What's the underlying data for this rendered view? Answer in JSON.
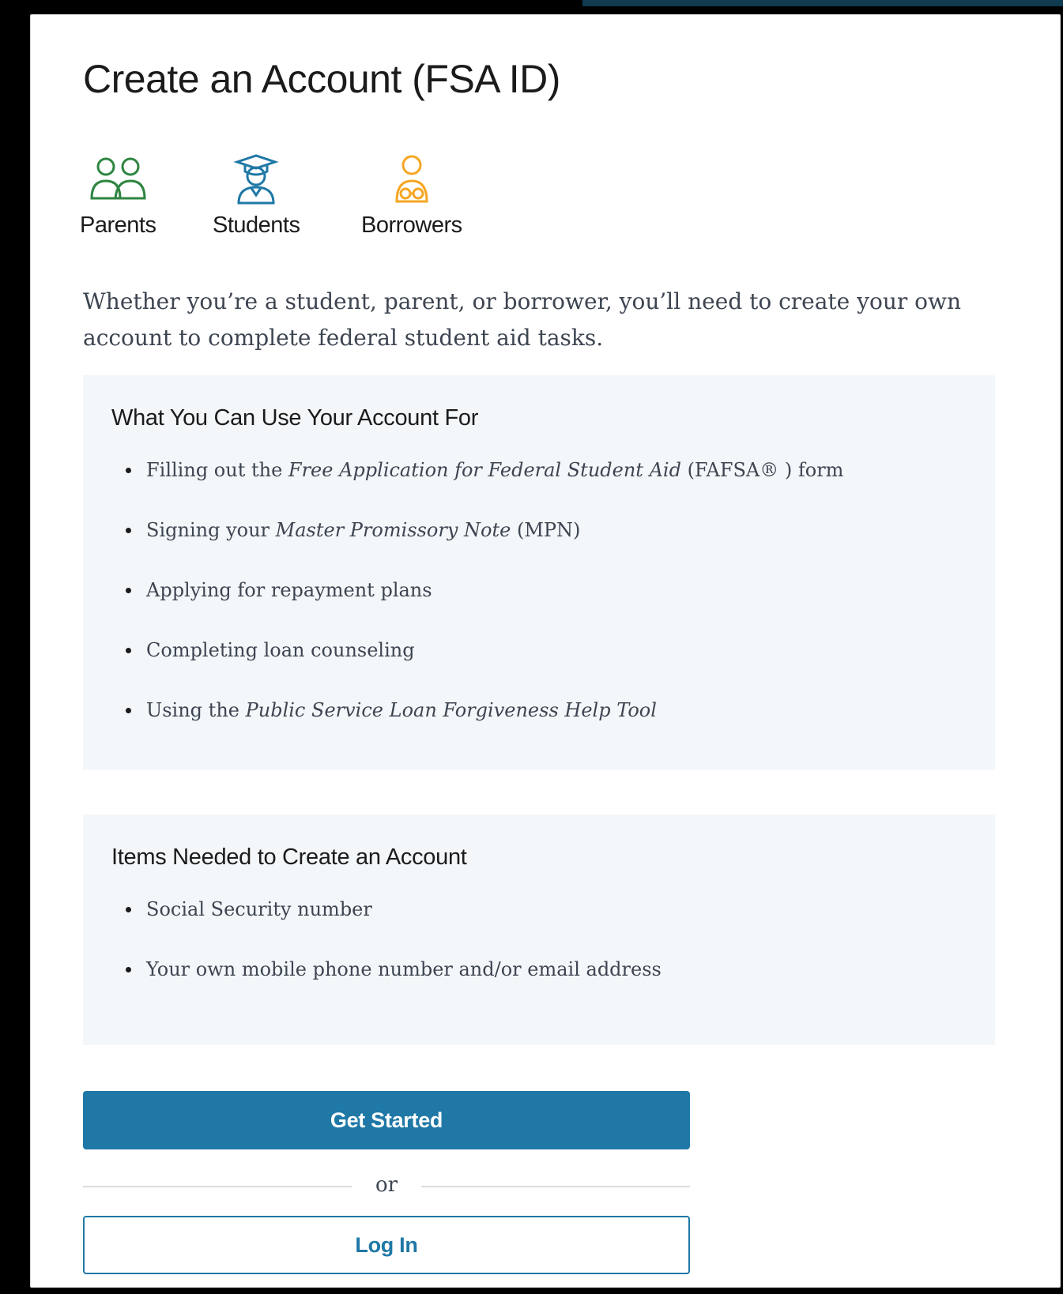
{
  "page": {
    "title": "Create an Account (FSA ID)",
    "intro": "Whether you’re a student, parent, or borrower, you’ll need to create your own account to complete federal student aid tasks."
  },
  "audiences": [
    {
      "label": "Parents",
      "icon": "parents-icon",
      "color": "#2e8540"
    },
    {
      "label": "Students",
      "icon": "student-graduate-icon",
      "color": "#1f78a6"
    },
    {
      "label": "Borrowers",
      "icon": "borrower-icon",
      "color": "#f5a623"
    }
  ],
  "uses_panel": {
    "title": "What You Can Use Your Account For",
    "items": [
      {
        "before": "Filling out the ",
        "italic": "Free Application for Federal Student Aid",
        "after": " (FAFSA® ) form"
      },
      {
        "before": "Signing your ",
        "italic": "Master Promissory Note",
        "after": " (MPN)"
      },
      {
        "before": "Applying for repayment plans",
        "italic": "",
        "after": ""
      },
      {
        "before": "Completing loan counseling",
        "italic": "",
        "after": ""
      },
      {
        "before": "Using the ",
        "italic": "Public Service Loan Forgiveness Help Tool",
        "after": ""
      }
    ]
  },
  "needed_panel": {
    "title": "Items Needed to Create an Account",
    "items": [
      "Social Security number",
      "Your own mobile phone number and/or email address"
    ]
  },
  "actions": {
    "primary_label": "Get Started",
    "divider_label": "or",
    "secondary_label": "Log In"
  },
  "colors": {
    "primary": "#1f78a6",
    "panel_bg": "#f4f7fa",
    "parents": "#2e8540",
    "students": "#1f78a6",
    "borrowers": "#f5a623"
  }
}
